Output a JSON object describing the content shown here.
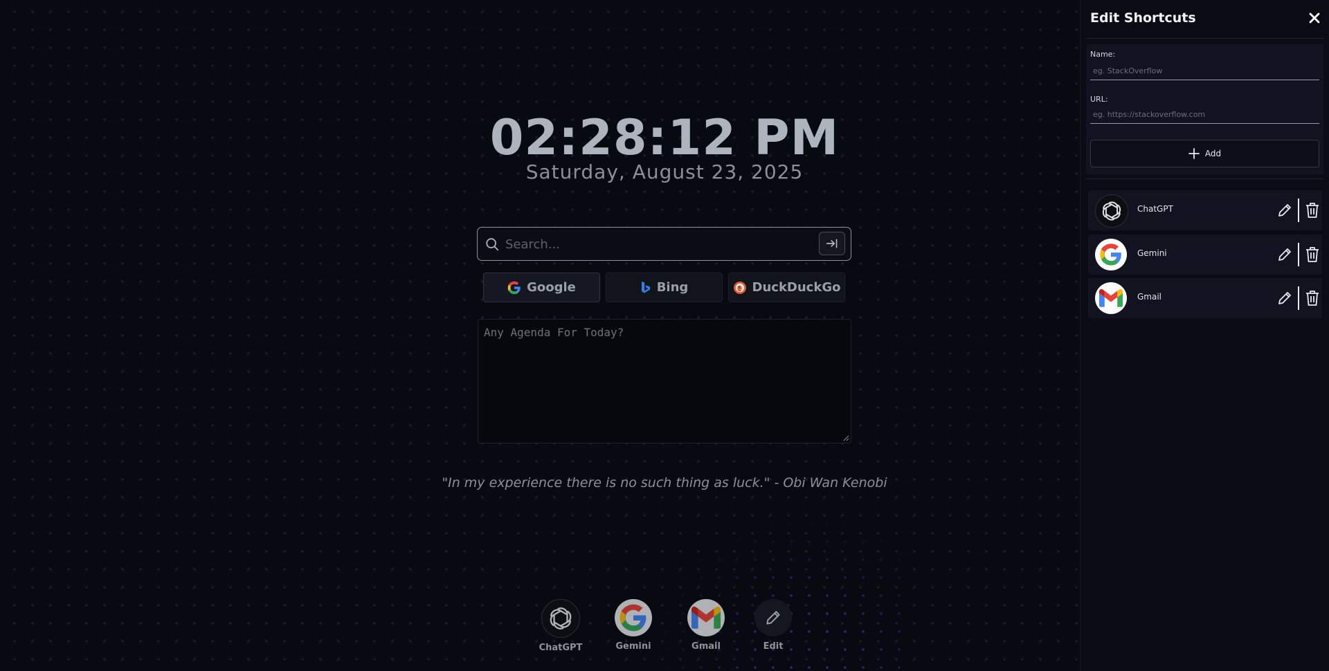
{
  "clock": {
    "time": "02:28:12 PM",
    "date": "Saturday, August 23, 2025"
  },
  "search": {
    "placeholder": "Search..."
  },
  "engines": [
    {
      "label": "Google",
      "icon": "google-icon",
      "selected": true
    },
    {
      "label": "Bing",
      "icon": "bing-icon",
      "selected": false
    },
    {
      "label": "DuckDuckGo",
      "icon": "duckduckgo-icon",
      "selected": false
    }
  ],
  "agenda": {
    "placeholder": "Any Agenda For Today?"
  },
  "quote": {
    "text": "\"In my experience there is no such thing as luck.\" - Obi Wan Kenobi"
  },
  "dock": [
    {
      "label": "ChatGPT",
      "icon": "chatgpt-icon"
    },
    {
      "label": "Gemini",
      "icon": "google-icon"
    },
    {
      "label": "Gmail",
      "icon": "gmail-icon"
    },
    {
      "label": "Edit",
      "icon": "pencil-icon"
    }
  ],
  "drawer": {
    "title": "Edit Shortcuts",
    "name_label": "Name:",
    "name_placeholder": "eg. StackOverflow",
    "url_label": "URL:",
    "url_placeholder": "eg. https://stackoverflow.com",
    "add_label": "Add",
    "shortcuts": [
      {
        "name": "ChatGPT",
        "icon": "chatgpt-icon"
      },
      {
        "name": "Gemini",
        "icon": "google-icon"
      },
      {
        "name": "Gmail",
        "icon": "gmail-icon"
      }
    ]
  },
  "colors": {
    "background": "#080a12",
    "panel": "#0a0c15",
    "card": "#111420",
    "accent_glow": "#463cdc",
    "text": "#c9ccd3"
  }
}
